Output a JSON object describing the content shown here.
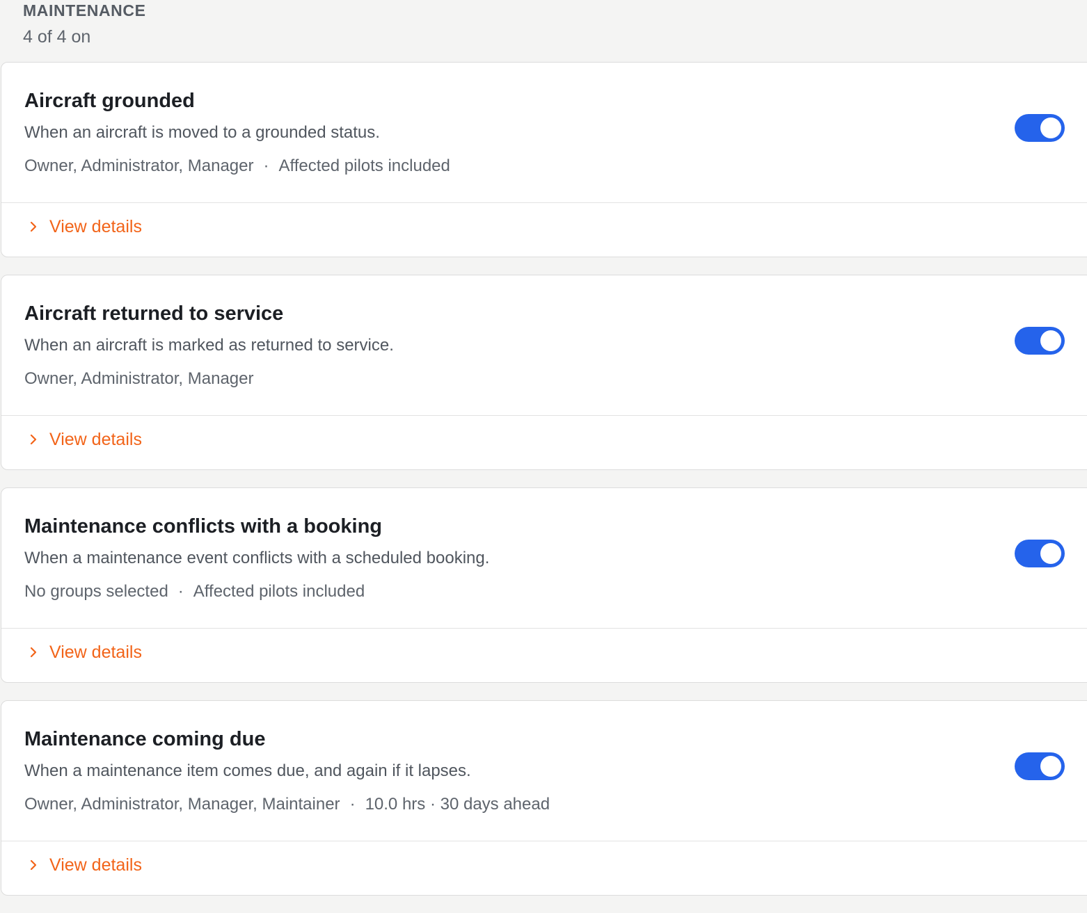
{
  "section": {
    "title": "MAINTENANCE",
    "count": "4 of 4 on"
  },
  "colors": {
    "toggle_on": "#2563eb",
    "link": "#f26419"
  },
  "cards": [
    {
      "title": "Aircraft grounded",
      "description": "When an aircraft is moved to a grounded status.",
      "groups": "Owner, Administrator, Manager",
      "separator": "·",
      "extra": "Affected pilots included",
      "enabled": true,
      "details_label": "View details",
      "details_icon": "chevron-right-icon"
    },
    {
      "title": "Aircraft returned to service",
      "description": "When an aircraft is marked as returned to service.",
      "groups": "Owner, Administrator, Manager",
      "enabled": true,
      "details_label": "View details",
      "details_icon": "chevron-right-icon"
    },
    {
      "title": "Maintenance conflicts with a booking",
      "description": "When a maintenance event conflicts with a scheduled booking.",
      "groups": "No groups selected",
      "separator": "·",
      "extra": "Affected pilots included",
      "enabled": true,
      "details_label": "View details",
      "details_icon": "chevron-right-icon"
    },
    {
      "title": "Maintenance coming due",
      "description": "When a maintenance item comes due, and again if it lapses.",
      "groups": "Owner, Administrator, Manager, Maintainer",
      "separator": "·",
      "extra": "10.0 hrs · 30 days ahead",
      "enabled": true,
      "details_label": "View details",
      "details_icon": "chevron-right-icon"
    }
  ]
}
